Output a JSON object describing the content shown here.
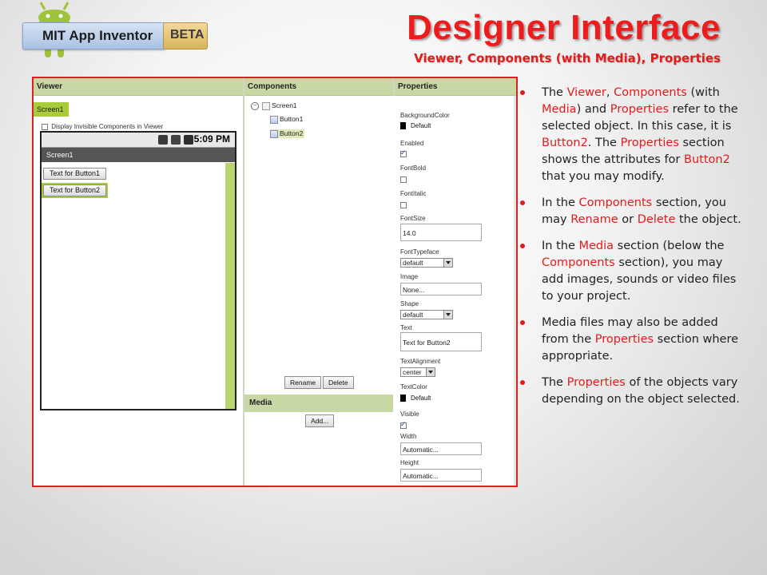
{
  "logo": {
    "brand": "MIT App Inventor",
    "badge": "BETA"
  },
  "header": {
    "title": "Designer Interface",
    "subtitle": "Viewer, Components (with Media), Properties"
  },
  "designer": {
    "viewer": {
      "header": "Viewer",
      "screen_tab": "Screen1",
      "invisible_checkbox_label": "Display Invisible Components in Viewer",
      "phone": {
        "time": "5:09 PM",
        "title": "Screen1",
        "buttons": [
          "Text for Button1",
          "Text for Button2"
        ]
      }
    },
    "components": {
      "header": "Components",
      "tree": {
        "root": "Screen1",
        "children": [
          "Button1",
          "Button2"
        ]
      },
      "rename_label": "Rename",
      "delete_label": "Delete",
      "media_header": "Media",
      "add_label": "Add..."
    },
    "properties": {
      "header": "Properties",
      "background_color": {
        "label": "BackgroundColor",
        "value": "Default"
      },
      "enabled": {
        "label": "Enabled"
      },
      "font_bold": {
        "label": "FontBold"
      },
      "font_italic": {
        "label": "FontItalic"
      },
      "font_size": {
        "label": "FontSize",
        "value": "14.0"
      },
      "font_typeface": {
        "label": "FontTypeface",
        "value": "default"
      },
      "image": {
        "label": "Image",
        "value": "None..."
      },
      "shape": {
        "label": "Shape",
        "value": "default"
      },
      "text": {
        "label": "Text",
        "value": "Text for Button2"
      },
      "text_alignment": {
        "label": "TextAlignment",
        "value": "center"
      },
      "text_color": {
        "label": "TextColor",
        "value": "Default"
      },
      "visible": {
        "label": "Visible"
      },
      "width": {
        "label": "Width",
        "value": "Automatic..."
      },
      "height": {
        "label": "Height",
        "value": "Automatic..."
      }
    }
  },
  "bullets": {
    "b1": {
      "p1": "The ",
      "h1": "Viewer",
      "p2": ", ",
      "h2": "Components",
      "p3": " (with ",
      "h3": "Media",
      "p4": ") and ",
      "h4": "Properties",
      "p5": " refer to the selected object. In this case, it is ",
      "h5": "Button2",
      "p6": ". The ",
      "h6": "Properties",
      "p7": " section shows the attributes for ",
      "h7": "Button2",
      "p8": " that you may modify."
    },
    "b2": {
      "p1": "In the ",
      "h1": "Components",
      "p2": " section, you may ",
      "h2": "Rename",
      "p3": " or ",
      "h3": "Delete",
      "p4": " the object."
    },
    "b3": {
      "p1": "In the ",
      "h1": "Media",
      "p2": " section (below the ",
      "h2": "Components",
      "p3": " section), you may add images, sounds or video files to your project."
    },
    "b4": {
      "p1": "Media files may also be added from the ",
      "h1": "Properties",
      "p2": " section where appropriate."
    },
    "b5": {
      "p1": "The ",
      "h1": "Properties",
      "p2": " of the objects vary depending on the object selected."
    }
  },
  "colors": {
    "title_red": "#ee1c1c",
    "highlight_red": "#e31b1b",
    "panel_header_green": "#c8d8a4",
    "selection_green": "#a8cc3c"
  }
}
